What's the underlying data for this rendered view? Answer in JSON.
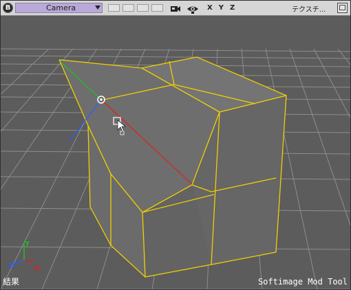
{
  "toolbar": {
    "b_label": "B",
    "camera_label": "Camera",
    "axis_x": "X",
    "axis_y": "Y",
    "axis_z": "Z",
    "texture_label": "テクスチ..."
  },
  "viewport": {
    "status_text": "結果",
    "brand_text": "Softimage Mod Tool",
    "gizmo": {
      "x": "X",
      "y": "Y",
      "z": "Z"
    }
  },
  "colors": {
    "toolbar_bg": "#d6d6d6",
    "camera_select_bg": "#b9a9d8",
    "viewport_bg": "#5c5c5c",
    "grid": "#8e8e8e",
    "selection_edge": "#f2d000",
    "axis_x": "#e02020",
    "axis_y": "#20c020",
    "axis_z": "#2a5cff"
  },
  "icons": [
    "b-menu-icon",
    "camera-dropdown-arrow-icon",
    "video-camera-icon",
    "eye-icon",
    "window-maximize-icon"
  ]
}
